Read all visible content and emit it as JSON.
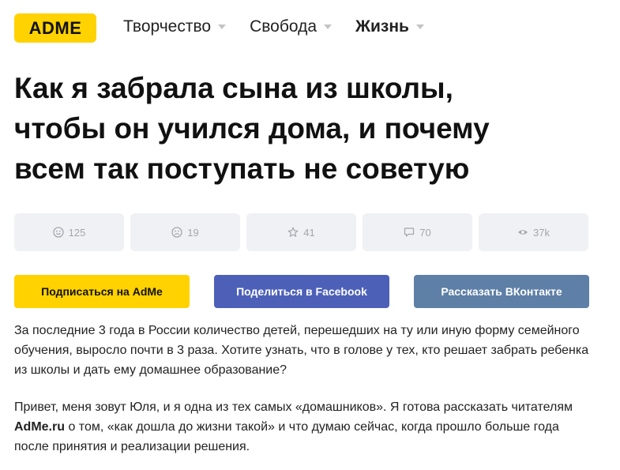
{
  "header": {
    "logo": "ADME",
    "nav": [
      {
        "label": "Творчество",
        "active": false
      },
      {
        "label": "Свобода",
        "active": false
      },
      {
        "label": "Жизнь",
        "active": true
      }
    ]
  },
  "article": {
    "title_lines": [
      "Как я забрала сына из школы,",
      "чтобы он учился дома, и почему",
      "всем так поступать не советую"
    ]
  },
  "stats": [
    {
      "icon": "smile-icon",
      "value": "125"
    },
    {
      "icon": "sad-icon",
      "value": "19"
    },
    {
      "icon": "star-icon",
      "value": "41"
    },
    {
      "icon": "comment-icon",
      "value": "70"
    },
    {
      "icon": "eye-icon",
      "value": "37k"
    }
  ],
  "actions": {
    "subscribe": "Подписаться на AdMe",
    "facebook": "Поделиться в Facebook",
    "vk": "Рассказать ВКонтакте"
  },
  "paragraphs": {
    "p1_lines": [
      "За последние 3 года в России количество детей, перешедших на ту или иную форму семейного",
      "обучения, выросло почти в 3 раза. Хотите узнать, что в голове у тех, кто решает забрать ребенка",
      "из школы и дать ему домашнее образование?"
    ],
    "p2_line1": "Привет, меня зовут Юля, и я одна из тех самых «домашников». Я готова рассказать читателям",
    "p2_bold": "AdMe.ru",
    "p2_line2_rest": " о том, «как дошла до жизни такой» и что думаю сейчас, когда прошло больше года",
    "p2_line3": "после принятия и реализации решения."
  },
  "colors": {
    "brand_yellow": "#ffd200",
    "facebook": "#4d60b8",
    "vk": "#5e7fa6",
    "stat_bg": "#f0f1f4"
  }
}
